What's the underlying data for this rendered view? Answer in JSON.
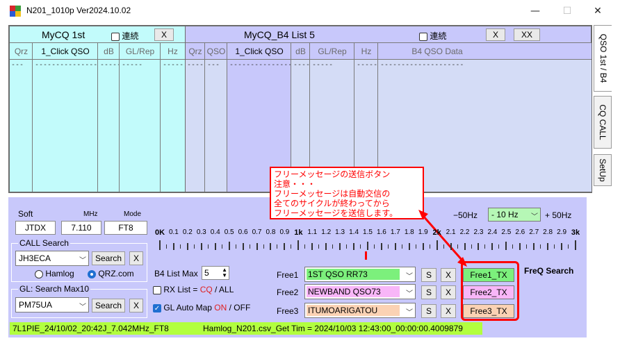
{
  "window": {
    "title": "N201_1010p   Ver2024.10.02",
    "min": "—",
    "max": "☐",
    "close": "✕"
  },
  "mycq": {
    "title": "MyCQ  1st",
    "renzoku": "連続",
    "x_label": "X",
    "cols": [
      "Qrz",
      "1_Click QSO",
      "dB",
      "GL/Rep",
      "Hz"
    ],
    "row": [
      "---",
      "--------------------",
      "-----",
      "-----",
      "-----"
    ]
  },
  "b4": {
    "title": "MyCQ_B4  List  5",
    "renzoku": "連続",
    "x_label": "X",
    "xx_label": "XX",
    "cols": [
      "Qrz",
      "QSO",
      "1_Click QSO",
      "dB",
      "GL/Rep",
      "Hz",
      "B4 QSO Data"
    ],
    "row": [
      "-----",
      "---",
      "--------------------",
      "-----",
      "-----",
      "-----",
      "--------------------"
    ]
  },
  "tabs": {
    "t1": "QSO  1st / B4",
    "t2": "CQ  CALL",
    "t3": "SetUp"
  },
  "note": {
    "line1": "フリーメッセージの送信ボタン",
    "line2": "注意・・・",
    "line3": "フリーメッセージは自動交信の",
    "line4": "全てのサイクルが終わってから",
    "line5": "フリーメッセージを送信します。"
  },
  "soft": {
    "label": "Soft",
    "value": "JTDX"
  },
  "mhz": {
    "label": "MHz",
    "value": "7.110"
  },
  "mode": {
    "label": "Mode",
    "value": "FT8"
  },
  "call_search": {
    "label": "CALL Search",
    "value": "JH3ECA",
    "search_label": "Search",
    "x_label": "X",
    "hamlog": "Hamlog",
    "qrz": "QRZ.com"
  },
  "gl_search": {
    "label": "GL:  Search Max10",
    "value": "PM75UA",
    "search_label": "Search",
    "x_label": "X"
  },
  "b4_list_max": {
    "label": "B4 List Max",
    "value": "5"
  },
  "rx_list": {
    "label": "RX List = ",
    "cq": "CQ",
    "all": " / ALL"
  },
  "gl_auto": {
    "label": "GL Auto Map ",
    "on": "ON",
    "off": " / OFF"
  },
  "freq": {
    "minus": "−50Hz",
    "offset": "- 10 Hz",
    "plus": "+ 50Hz",
    "search": "FreQ Search",
    "unit_k": "k",
    "scale": [
      "0K",
      "0.1",
      "0.2",
      "0.3",
      "0.4",
      "0.5",
      "0.6",
      "0.7",
      "0.8",
      "0.9",
      "1k",
      "1.1",
      "1.2",
      "1.3",
      "1.4",
      "1.5",
      "1.6",
      "1.7",
      "1.8",
      "1.9",
      "2k",
      "2.1",
      "2.2",
      "2.3",
      "2.4",
      "2.5",
      "2.6",
      "2.7",
      "2.8",
      "2.9",
      "3k"
    ]
  },
  "free": [
    {
      "label": "Free1",
      "value": "1ST QSO RR73",
      "s": "S",
      "x": "X",
      "tx": "Free1_TX",
      "color": "#7cf07c"
    },
    {
      "label": "Free2",
      "value": "NEWBAND QSO73",
      "s": "S",
      "x": "X",
      "tx": "Free2_TX",
      "color": "#f8b6f8"
    },
    {
      "label": "Free3",
      "value": "ITUMOARIGATOU",
      "s": "S",
      "x": "X",
      "tx": "Free3_TX",
      "color": "#fbd2b4"
    }
  ],
  "status": {
    "left": "7L1PIE_24/10/02_20:42J_7.042MHz_FT8",
    "right": "Hamlog_N201.csv_Get Tim = 2024/10/03 12:43:00_00:00:00.4009879"
  },
  "colors": {
    "panel": "#c8c8fb",
    "mycq_bg": "#c2fbfb",
    "b4_bg": "#c8c8fb",
    "status_bg": "#b2ff3f",
    "note_border": "#ff0000"
  }
}
